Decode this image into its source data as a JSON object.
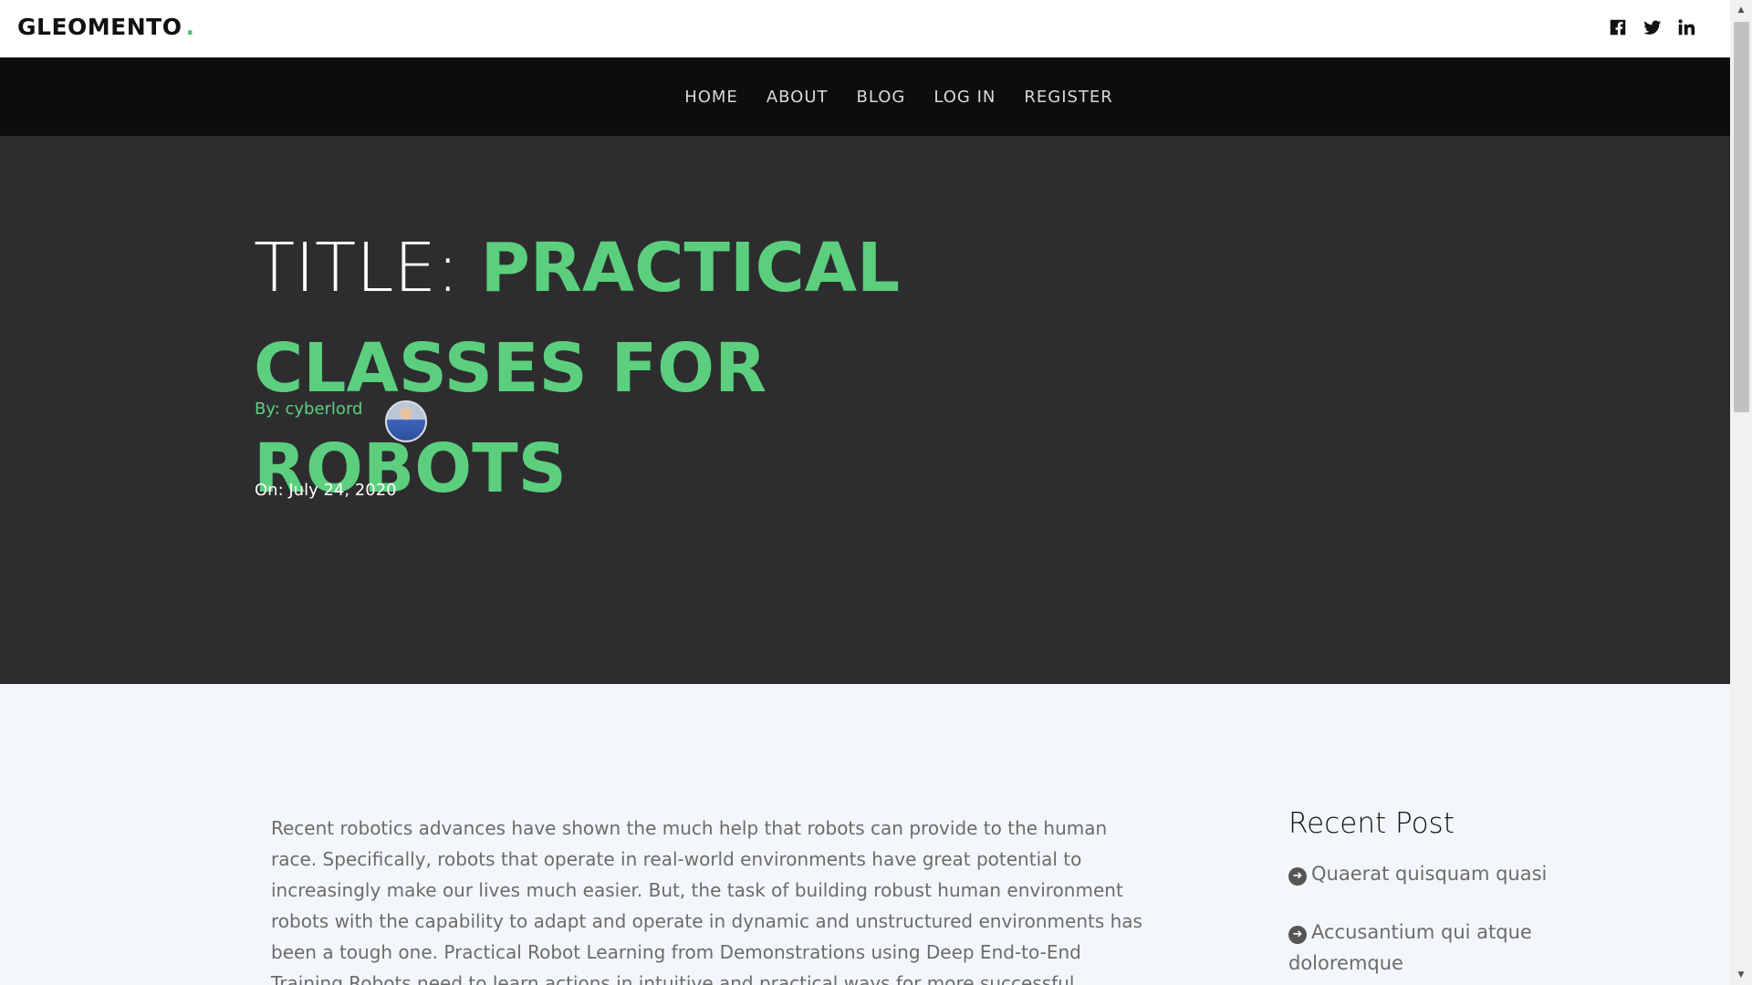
{
  "header": {
    "brand": "GLEOMENTO",
    "brand_dot": ".",
    "social": [
      "facebook-icon",
      "twitter-icon",
      "linkedin-icon"
    ]
  },
  "nav": {
    "items": [
      "HOME",
      "ABOUT",
      "BLOG",
      "LOG IN",
      "REGISTER"
    ]
  },
  "hero": {
    "title_prefix": "TITLE: ",
    "title_accent": "PRACTICAL CLASSES FOR ROBOTS",
    "author": "By: cyberlord",
    "date": "On: July 24, 2020"
  },
  "article": {
    "body": "Recent robotics advances have shown the much help that robots can provide to the human race. Specifically, robots that operate in real-world environments have great potential to increasingly make our lives much easier. But, the task of building robust human environment robots with the capability to adapt and operate in dynamic and unstructured environments has been a tough one. Practical Robot Learning from Demonstrations using Deep End-to-End Training Robots need to learn actions in intuitive and practical ways for more successful deployment in human environments. And, robotics research has"
  },
  "sidebar": {
    "title": "Recent Post",
    "posts": [
      "Quaerat quisquam quasi",
      "Accusantium qui atque doloremque"
    ]
  },
  "colors": {
    "accent": "#5ccf7e",
    "hero_bg": "#2d2d2f",
    "nav_bg": "#0d0d0d",
    "page_bg": "#f4f7fa"
  }
}
